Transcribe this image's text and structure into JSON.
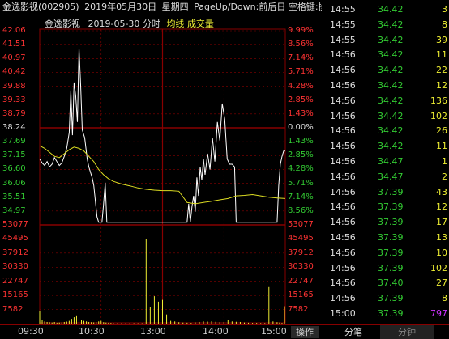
{
  "header": {
    "stock": "金逸影视(002905)",
    "date": "2019年05月30日",
    "weekday": "星期四",
    "hint": "PageUp/Down:前后日 空格键:操作 通达信(R)"
  },
  "chart_header": {
    "name": "金逸影视",
    "date": "2019-05-30",
    "mode": "分时",
    "avg_label": "均线",
    "vol_label": "成交量"
  },
  "colors": {
    "up": "#ff3333",
    "down": "#33cc33",
    "price_line": "#ffffff",
    "avg_line": "#dddd22",
    "volume": "#eeee33",
    "grid": "#880000"
  },
  "chart_data": [
    {
      "type": "line",
      "title": "金逸影视 2019-05-30 分时",
      "y_ticks_left": [
        "42.06",
        "41.51",
        "40.97",
        "40.42",
        "39.88",
        "39.33",
        "38.79",
        "38.24",
        "37.69",
        "37.15",
        "36.60",
        "36.06",
        "35.51",
        "34.97"
      ],
      "y_ticks_right": [
        "9.99%",
        "8.56%",
        "7.14%",
        "5.71%",
        "4.28%",
        "2.85%",
        "1.43%",
        "0.00%",
        "1.43%",
        "2.85%",
        "4.28%",
        "5.71%",
        "7.14%",
        "8.56%"
      ],
      "prev_close": 38.24,
      "ylim": [
        34.7,
        42.06
      ],
      "x_ticks": [
        "09:30",
        "10:30",
        "13:00",
        "14:00",
        "15:00"
      ],
      "series": [
        {
          "name": "价格",
          "x": [
            0,
            3,
            6,
            9,
            12,
            15,
            18,
            21,
            24,
            27,
            30,
            33,
            36,
            38,
            40,
            42,
            44,
            46,
            48,
            50,
            52,
            55,
            58,
            60,
            62,
            64,
            66,
            68,
            70,
            72,
            74,
            76,
            78,
            80,
            82,
            84,
            86,
            88,
            90,
            92,
            94,
            96,
            98,
            100,
            102,
            104,
            106,
            108,
            110,
            112,
            114,
            116,
            118,
            120,
            125,
            130,
            135,
            140,
            145,
            150,
            155,
            160,
            165,
            170,
            175,
            180,
            182,
            184,
            186,
            188,
            190,
            192,
            194,
            196,
            198,
            200,
            202,
            205,
            208,
            211,
            214,
            217,
            220,
            223,
            226,
            229,
            232,
            235,
            238,
            240,
            245,
            250,
            255,
            260,
            265,
            270,
            275,
            280,
            285,
            290,
            292,
            294,
            296,
            298,
            300
          ],
          "values": [
            37.2,
            37.05,
            36.95,
            37.1,
            36.9,
            37.0,
            37.25,
            37.1,
            36.95,
            37.05,
            37.3,
            37.6,
            38.2,
            39.8,
            38.1,
            40.1,
            39.6,
            38.6,
            41.4,
            40.0,
            38.3,
            38.0,
            37.2,
            36.9,
            36.7,
            36.5,
            36.2,
            35.6,
            35.0,
            34.8,
            34.8,
            34.8,
            35.5,
            36.3,
            34.8,
            34.8,
            34.8,
            34.8,
            34.8,
            34.8,
            34.8,
            34.8,
            34.8,
            34.8,
            34.8,
            34.8,
            34.8,
            34.8,
            34.8,
            34.8,
            34.8,
            34.8,
            34.8,
            34.8,
            34.8,
            34.8,
            34.8,
            34.8,
            34.8,
            34.8,
            34.8,
            34.8,
            34.8,
            34.8,
            34.8,
            34.8,
            35.5,
            34.8,
            35.4,
            35.8,
            35.2,
            36.5,
            35.8,
            36.9,
            36.4,
            37.2,
            36.6,
            37.4,
            36.8,
            38.0,
            37.1,
            38.6,
            37.9,
            39.3,
            38.7,
            37.2,
            37.0,
            37.0,
            36.9,
            34.8,
            34.8,
            34.8,
            34.8,
            34.8,
            34.8,
            34.8,
            34.8,
            34.8,
            34.8,
            34.8,
            36.2,
            37.0,
            37.3,
            37.5,
            37.5
          ]
        },
        {
          "name": "均价",
          "x": [
            0,
            6,
            12,
            18,
            24,
            30,
            36,
            42,
            48,
            54,
            60,
            66,
            72,
            78,
            84,
            90,
            100,
            110,
            120,
            130,
            140,
            150,
            160,
            170,
            180,
            190,
            200,
            210,
            220,
            230,
            240,
            250,
            260,
            270,
            280,
            290,
            300
          ],
          "values": [
            37.7,
            37.6,
            37.45,
            37.3,
            37.25,
            37.4,
            37.55,
            37.65,
            37.6,
            37.5,
            37.3,
            37.1,
            36.8,
            36.6,
            36.45,
            36.35,
            36.25,
            36.18,
            36.1,
            36.05,
            36.02,
            36.0,
            36.0,
            35.98,
            35.55,
            35.5,
            35.55,
            35.6,
            35.65,
            35.7,
            35.8,
            35.82,
            35.85,
            35.8,
            35.75,
            35.72,
            35.7
          ]
        }
      ]
    },
    {
      "type": "bar",
      "title": "成交量",
      "y_ticks": [
        "53077",
        "45495",
        "37912",
        "30330",
        "22747",
        "15165",
        "7582"
      ],
      "ylim": [
        0,
        53077
      ],
      "x": [
        0,
        3,
        6,
        9,
        12,
        15,
        18,
        21,
        24,
        27,
        30,
        33,
        36,
        39,
        42,
        45,
        48,
        51,
        54,
        57,
        60,
        63,
        66,
        69,
        72,
        75,
        78,
        81,
        84,
        87,
        90,
        95,
        100,
        105,
        110,
        115,
        120,
        125,
        130,
        135,
        140,
        145,
        150,
        155,
        160,
        165,
        170,
        175,
        180,
        185,
        190,
        195,
        200,
        205,
        210,
        215,
        220,
        225,
        230,
        235,
        240,
        245,
        250,
        255,
        260,
        265,
        270,
        275,
        280,
        285,
        290,
        293,
        296,
        299
      ],
      "values": [
        7000,
        2200,
        1200,
        900,
        800,
        600,
        900,
        500,
        600,
        700,
        900,
        1100,
        1500,
        2600,
        3500,
        4500,
        3000,
        2000,
        1500,
        1200,
        900,
        800,
        700,
        900,
        1200,
        1500,
        800,
        600,
        500,
        400,
        300,
        200,
        200,
        200,
        200,
        200,
        200,
        200,
        46000,
        9000,
        15000,
        12000,
        13000,
        5000,
        1500,
        1200,
        800,
        600,
        500,
        400,
        700,
        900,
        1200,
        1100,
        1300,
        1000,
        800,
        900,
        2000,
        1200,
        1000,
        900,
        600,
        500,
        400,
        400,
        300,
        300,
        20000,
        1200,
        800,
        600,
        400,
        9500
      ]
    }
  ],
  "trades": [
    {
      "time": "14:55",
      "price": "34.42",
      "vol": "3"
    },
    {
      "time": "14:55",
      "price": "34.42",
      "vol": "8"
    },
    {
      "time": "14:55",
      "price": "34.42",
      "vol": "39"
    },
    {
      "time": "14:56",
      "price": "34.42",
      "vol": "11"
    },
    {
      "time": "14:56",
      "price": "34.42",
      "vol": "22"
    },
    {
      "time": "14:56",
      "price": "34.42",
      "vol": "12"
    },
    {
      "time": "14:56",
      "price": "34.42",
      "vol": "136"
    },
    {
      "time": "14:56",
      "price": "34.42",
      "vol": "102"
    },
    {
      "time": "14:56",
      "price": "34.42",
      "vol": "26"
    },
    {
      "time": "14:56",
      "price": "34.42",
      "vol": "11"
    },
    {
      "time": "14:56",
      "price": "34.47",
      "vol": "1"
    },
    {
      "time": "14:56",
      "price": "34.47",
      "vol": "2"
    },
    {
      "time": "14:56",
      "price": "37.39",
      "vol": "43"
    },
    {
      "time": "14:56",
      "price": "37.39",
      "vol": "12"
    },
    {
      "time": "14:56",
      "price": "37.39",
      "vol": "17"
    },
    {
      "time": "14:56",
      "price": "37.39",
      "vol": "13"
    },
    {
      "time": "14:56",
      "price": "37.39",
      "vol": "10"
    },
    {
      "time": "14:56",
      "price": "37.39",
      "vol": "102"
    },
    {
      "time": "14:56",
      "price": "37.40",
      "vol": "27"
    },
    {
      "time": "14:56",
      "price": "37.39",
      "vol": "8"
    },
    {
      "time": "15:00",
      "price": "37.39",
      "vol": "797",
      "highlight": true
    }
  ],
  "bottom": {
    "times": [
      "09:30",
      "10:30",
      "13:00",
      "14:00",
      "15:00"
    ],
    "op_label": "操作",
    "tab_trades": "分笔",
    "tab_minute": "分钟"
  }
}
